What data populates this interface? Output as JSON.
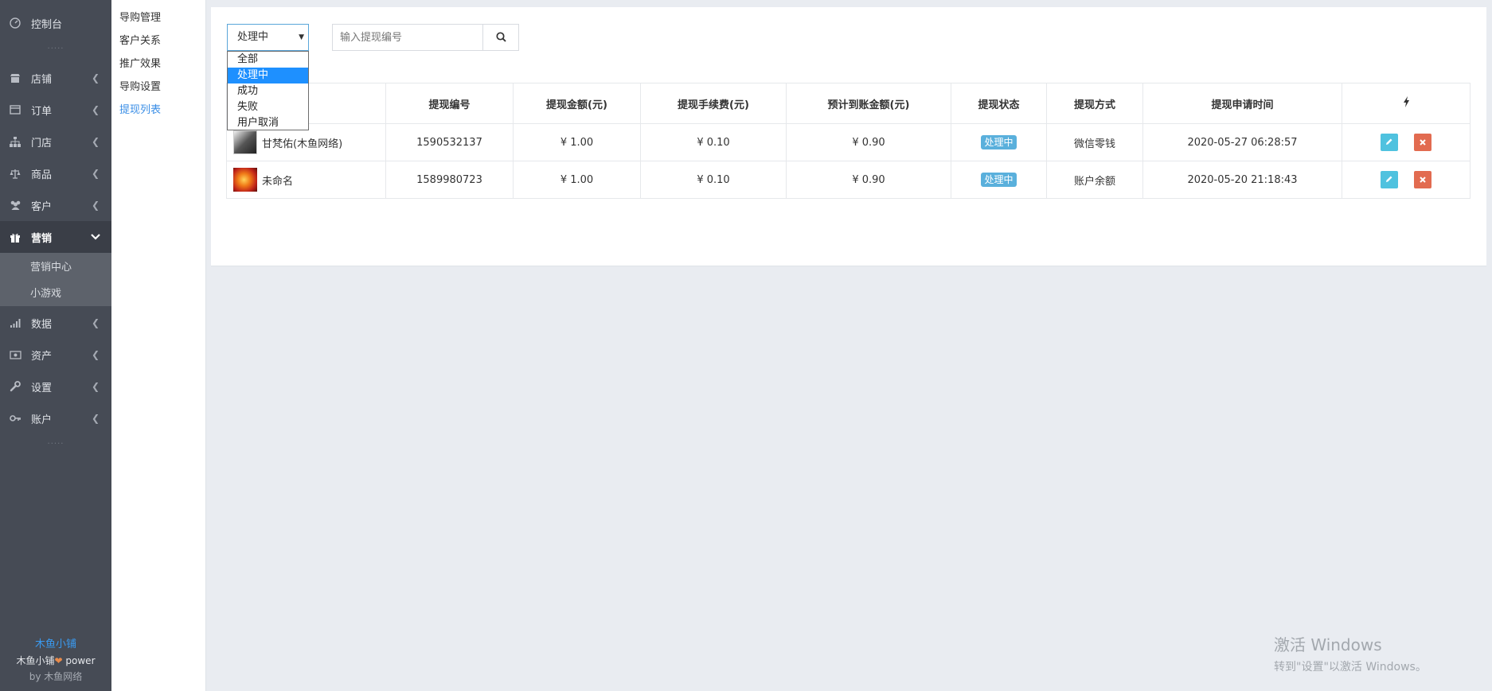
{
  "sidebar": {
    "dashboard": "控制台",
    "items": [
      {
        "label": "店铺",
        "icon": "store-icon"
      },
      {
        "label": "订单",
        "icon": "order-icon"
      },
      {
        "label": "门店",
        "icon": "sitemap-icon"
      },
      {
        "label": "商品",
        "icon": "balance-icon"
      },
      {
        "label": "客户",
        "icon": "users-icon"
      },
      {
        "label": "营销",
        "icon": "gift-icon"
      },
      {
        "label": "数据",
        "icon": "chart-bars-icon"
      },
      {
        "label": "资产",
        "icon": "money-icon"
      },
      {
        "label": "设置",
        "icon": "wrench-icon"
      },
      {
        "label": "账户",
        "icon": "key-icon"
      }
    ],
    "submenu": [
      "营销中心",
      "小游戏"
    ],
    "footer": {
      "brand": "木鱼小铺",
      "power": "木鱼小铺",
      "power_suffix": "power",
      "by": "by 木鱼网络"
    }
  },
  "submenu": {
    "items": [
      "导购管理",
      "客户关系",
      "推广效果",
      "导购设置",
      "提现列表"
    ],
    "active_index": 4
  },
  "filter": {
    "selected": "处理中",
    "options": [
      "全部",
      "处理中",
      "成功",
      "失败",
      "用户取消"
    ],
    "search_placeholder": "输入提现编号"
  },
  "table": {
    "headers": [
      "",
      "提现编号",
      "提现金额(元)",
      "提现手续费(元)",
      "预计到账金额(元)",
      "提现状态",
      "提现方式",
      "提现申请时间"
    ],
    "rows": [
      {
        "user": "甘梵佑(木鱼网络)",
        "id": "1590532137",
        "amount": "¥ 1.00",
        "fee": "¥ 0.10",
        "net": "¥ 0.90",
        "status": "处理中",
        "method": "微信零钱",
        "time": "2020-05-27 06:28:57"
      },
      {
        "user": "未命名",
        "id": "1589980723",
        "amount": "¥ 1.00",
        "fee": "¥ 0.10",
        "net": "¥ 0.90",
        "status": "处理中",
        "method": "账户余额",
        "time": "2020-05-20 21:18:43"
      }
    ]
  },
  "watermark": {
    "line1": "激活 Windows",
    "line2": "转到\"设置\"以激活 Windows。"
  },
  "colors": {
    "sidebar_bg": "#464b55",
    "accent": "#3a8ee6",
    "badge": "#5ab0dc",
    "edit": "#4fc2df",
    "delete": "#e26b50"
  }
}
